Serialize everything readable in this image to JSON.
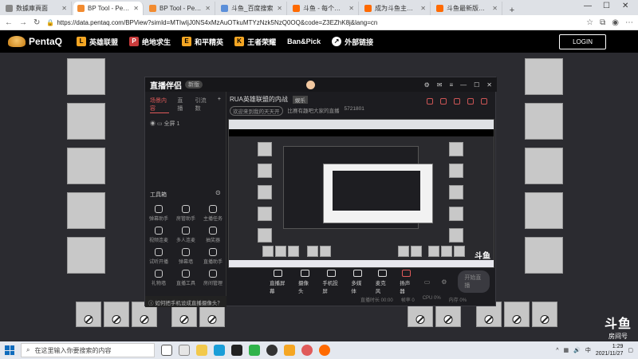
{
  "browser": {
    "tabs": [
      {
        "label": "数據庫頁面",
        "favicon": "page-icon",
        "active": false
      },
      {
        "label": "BP Tool - PentaQ",
        "favicon": "pentaq-icon",
        "active": true
      },
      {
        "label": "BP Tool - PentaQ",
        "favicon": "pentaq-icon",
        "active": false
      },
      {
        "label": "斗鱼_百度搜索",
        "favicon": "baidu-icon",
        "active": false
      },
      {
        "label": "斗鱼 - 每个人的直播平",
        "favicon": "douyu-icon",
        "active": false
      },
      {
        "label": "成为斗鱼主播 - 斗鱼",
        "favicon": "douyu-icon",
        "active": false
      },
      {
        "label": "斗鱼最新版下载中心",
        "favicon": "douyu-icon",
        "active": false
      }
    ],
    "new_tab": "+",
    "url": "https://data.pentaq.com/BPView?simId=MTIwIjJ0NS4xMzAuOTkuMTYzNzk5NzQ0OQ&code=Z3EZhK8j&lang=cn"
  },
  "site": {
    "logo_text": "PentaQ",
    "nav": [
      {
        "label": "英雄联盟",
        "icon": "lol-icon"
      },
      {
        "label": "绝地求生",
        "icon": "pubg-icon"
      },
      {
        "label": "和平精英",
        "icon": "peace-elite-icon"
      },
      {
        "label": "王者荣耀",
        "icon": "honor-of-kings-icon"
      },
      {
        "label": "Ban&Pick",
        "icon": ""
      },
      {
        "label": "外部链接",
        "icon": "external-link-icon"
      }
    ],
    "login_label": "LOGIN"
  },
  "app": {
    "name": "直播伴侣",
    "version": "新版",
    "left_tabs": [
      "场景内容",
      "直播",
      "引流数"
    ],
    "scene_row": "全屏 1",
    "toolbox_title": "工具箱",
    "tools": [
      {
        "label": "弹幕助手",
        "icon": "danmaku-icon"
      },
      {
        "label": "房管助手",
        "icon": "room-admin-icon"
      },
      {
        "label": "主播任务",
        "icon": "task-icon"
      },
      {
        "label": "视频连麦",
        "icon": "video-link-icon"
      },
      {
        "label": "多人连麦",
        "icon": "multi-link-icon"
      },
      {
        "label": "抽奖器",
        "icon": "lottery-icon"
      },
      {
        "label": "试听开播",
        "icon": "trial-icon"
      },
      {
        "label": "弹幕墙",
        "icon": "danmaku-wall-icon"
      },
      {
        "label": "直播助手",
        "icon": "live-assistant-icon"
      },
      {
        "label": "礼物墙",
        "icon": "gift-wall-icon"
      },
      {
        "label": "直播工具",
        "icon": "live-tools-icon"
      },
      {
        "label": "房间管理",
        "icon": "room-manage-icon"
      }
    ],
    "bottom_tip": "如何把手机设成直播摄像头？",
    "stream_title": "RUA英雄联盟的内战",
    "stream_tag": "娱乐",
    "sub_info": [
      "欢迎来到我的天天开",
      "比赛有趣吧大家的直播",
      "5721801"
    ],
    "bar_buttons": [
      {
        "label": "直播屏幕",
        "icon": "screen-icon"
      },
      {
        "label": "摄像头",
        "icon": "camera-icon"
      },
      {
        "label": "手机投屏",
        "icon": "phone-cast-icon"
      },
      {
        "label": "多媒体",
        "icon": "media-icon"
      },
      {
        "label": "麦克风",
        "icon": "mic-icon"
      },
      {
        "label": "扬声器",
        "icon": "speaker-icon"
      }
    ],
    "live_button": "开始直播",
    "status": [
      "直播时长 00:00",
      "帧率 0",
      "CPU 0%",
      "内存 0%"
    ],
    "capture_logo": "斗鱼"
  },
  "watermark": {
    "brand": "斗鱼",
    "sub": "房间号",
    "room": "5721801"
  },
  "taskbar": {
    "search_placeholder": "在这里输入你要搜索的内容",
    "time": "1:29",
    "date": "2021/11/27",
    "apps": [
      "app-1",
      "app-2",
      "app-3",
      "app-4",
      "app-5",
      "app-6",
      "app-7",
      "app-8",
      "app-9",
      "app-10"
    ]
  }
}
